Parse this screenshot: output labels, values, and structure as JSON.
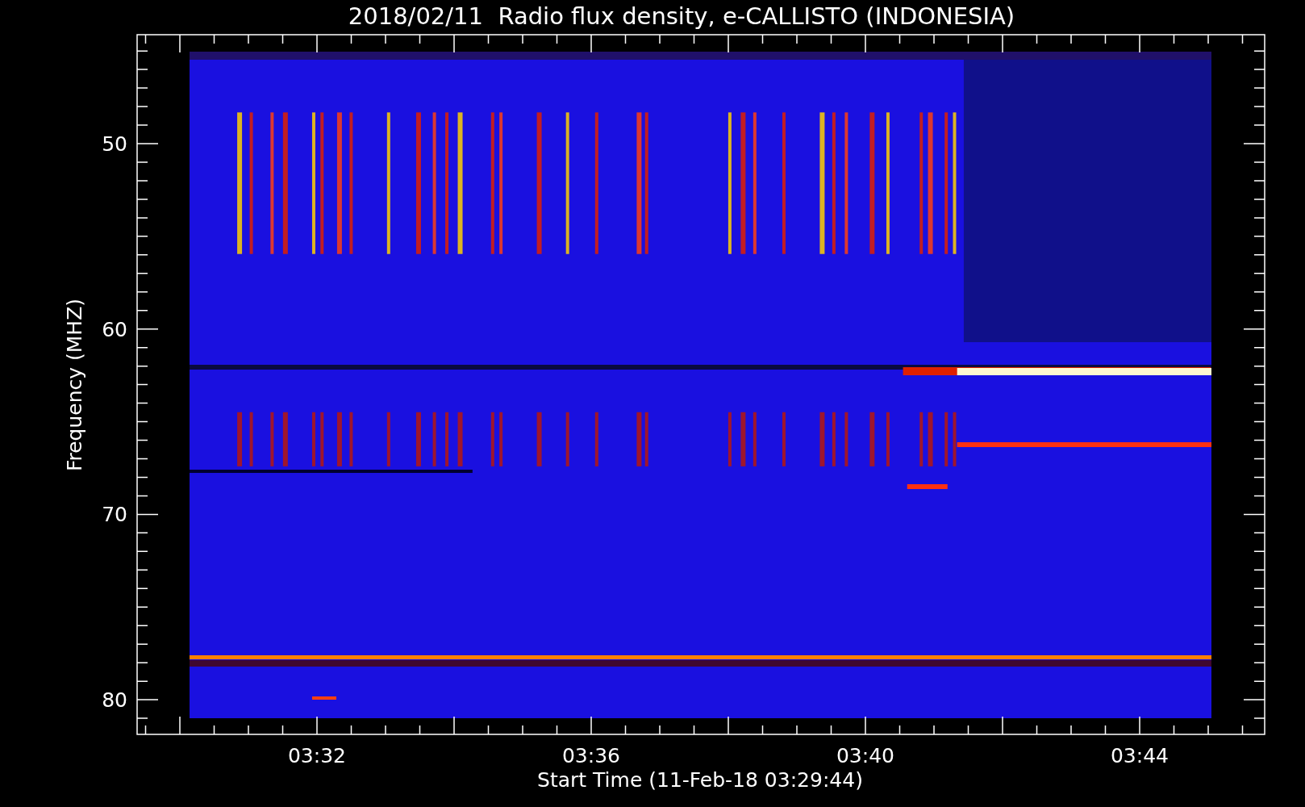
{
  "chart": {
    "title": "2018/02/11  Radio flux density, e-CALLISTO (INDONESIA)",
    "x_axis": {
      "label": "Start Time (11-Feb-18 03:29:44)",
      "ticks": [
        "03:32",
        "03:36",
        "03:40",
        "03:44"
      ]
    },
    "y_axis": {
      "label": "Frequency (MHZ)",
      "ticks": [
        "50",
        "60",
        "70",
        "80"
      ]
    }
  }
}
